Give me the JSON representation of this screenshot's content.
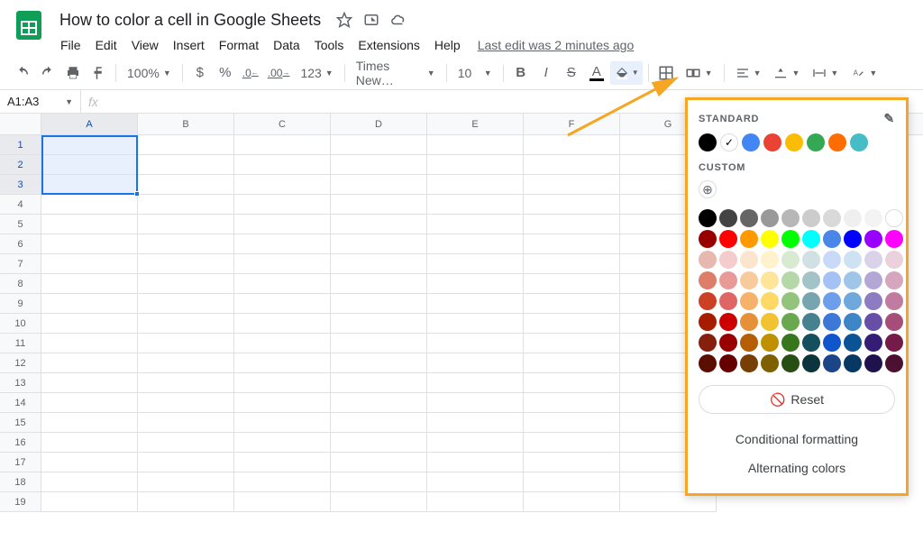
{
  "doc": {
    "title": "How  to color a cell in Google Sheets",
    "last_edit": "Last edit was 2 minutes ago"
  },
  "menus": [
    "File",
    "Edit",
    "View",
    "Insert",
    "Format",
    "Data",
    "Tools",
    "Extensions",
    "Help"
  ],
  "toolbar": {
    "zoom": "100%",
    "font": "Times New…",
    "font_size": "10",
    "currency": "$",
    "percent": "%",
    "dec_dec": ".0",
    "dec_inc": ".00",
    "more_formats": "123",
    "bold": "B",
    "italic": "I",
    "strike": "S",
    "text_color": "A"
  },
  "namebox": "A1:A3",
  "fx": "fx",
  "columns": [
    "A",
    "B",
    "C",
    "D",
    "E",
    "F",
    "G"
  ],
  "rows": [
    1,
    2,
    3,
    4,
    5,
    6,
    7,
    8,
    9,
    10,
    11,
    12,
    13,
    14,
    15,
    16,
    17,
    18,
    19
  ],
  "selected_col": "A",
  "selected_rows": [
    1,
    2,
    3
  ],
  "picker": {
    "standard_label": "STANDARD",
    "custom_label": "CUSTOM",
    "reset": "Reset",
    "conditional": "Conditional formatting",
    "alternating": "Alternating colors",
    "standard_colors": [
      "#000000",
      "check",
      "#4285f4",
      "#ea4335",
      "#fbbc04",
      "#34a853",
      "#ff6d01",
      "#46bdc6"
    ],
    "palette": [
      "#000000",
      "#434343",
      "#666666",
      "#999999",
      "#b7b7b7",
      "#cccccc",
      "#d9d9d9",
      "#efefef",
      "#f3f3f3",
      "#ffffff",
      "#980000",
      "#ff0000",
      "#ff9900",
      "#ffff00",
      "#00ff00",
      "#00ffff",
      "#4a86e8",
      "#0000ff",
      "#9900ff",
      "#ff00ff",
      "#e6b8af",
      "#f4cccc",
      "#fce5cd",
      "#fff2cc",
      "#d9ead3",
      "#d0e0e3",
      "#c9daf8",
      "#cfe2f3",
      "#d9d2e9",
      "#ead1dc",
      "#dd7e6b",
      "#ea9999",
      "#f9cb9c",
      "#ffe599",
      "#b6d7a8",
      "#a2c4c9",
      "#a4c2f4",
      "#9fc5e8",
      "#b4a7d6",
      "#d5a6bd",
      "#cc4125",
      "#e06666",
      "#f6b26b",
      "#ffd966",
      "#93c47d",
      "#76a5af",
      "#6d9eeb",
      "#6fa8dc",
      "#8e7cc3",
      "#c27ba0",
      "#a61c00",
      "#cc0000",
      "#e69138",
      "#f1c232",
      "#6aa84f",
      "#45818e",
      "#3c78d8",
      "#3d85c6",
      "#674ea7",
      "#a64d79",
      "#85200c",
      "#990000",
      "#b45f06",
      "#bf9000",
      "#38761d",
      "#134f5c",
      "#1155cc",
      "#0b5394",
      "#351c75",
      "#741b47",
      "#5b0f00",
      "#660000",
      "#783f04",
      "#7f6000",
      "#274e13",
      "#0c343d",
      "#1c4587",
      "#073763",
      "#20124d",
      "#4c1130"
    ]
  }
}
